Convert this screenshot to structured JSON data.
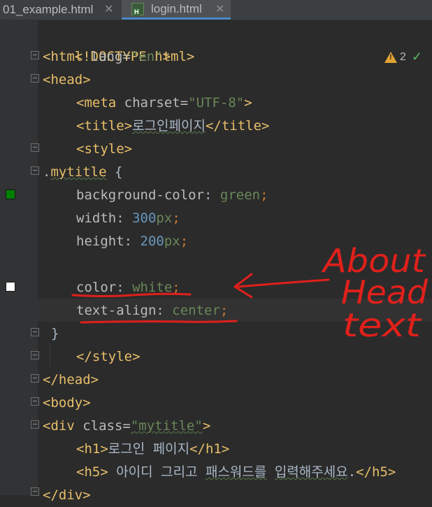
{
  "tabs": [
    {
      "label": "01_example.html",
      "close": "✕",
      "active": false
    },
    {
      "label": "login.html",
      "close": "✕",
      "active": true
    }
  ],
  "inspection": {
    "warning_count": "2",
    "icons": [
      "warning-icon",
      "check-icon"
    ]
  },
  "code": {
    "l1": {
      "a": "<!DOCTYPE html>"
    },
    "l2": {
      "a": "<html ",
      "b": "lang",
      "c": "=",
      "d": "\"en\"",
      "e": ">"
    },
    "l3": {
      "a": "<head>"
    },
    "l4": {
      "a": "<meta ",
      "b": "charset",
      "c": "=",
      "d": "\"UTF-8\"",
      "e": ">"
    },
    "l5": {
      "a": "<title>",
      "b": "로그인페이지",
      "c": "</title>"
    },
    "l6": {
      "a": "<style>"
    },
    "l7": {
      "a": ".",
      "b": "mytitle",
      "c": " {"
    },
    "l8": {
      "a": "background-color",
      "b": ": ",
      "c": "green",
      "d": ";"
    },
    "l9": {
      "a": "width",
      "b": ": ",
      "c": "300",
      "d": "px",
      "e": ";"
    },
    "l10": {
      "a": "height",
      "b": ": ",
      "c": "200",
      "d": "px",
      "e": ";"
    },
    "l12": {
      "a": "color",
      "b": ": ",
      "c": "white",
      "d": ";"
    },
    "l13": {
      "a": "text-align",
      "b": ": ",
      "c": "center",
      "d": ";"
    },
    "l14": {
      "a": "}"
    },
    "l15": {
      "a": "</style>"
    },
    "l16": {
      "a": "</head>"
    },
    "l17": {
      "a": "<body>"
    },
    "l18": {
      "a": "<div ",
      "b": "class",
      "c": "=",
      "d": "\"mytitle\"",
      "e": ">"
    },
    "l19": {
      "a": "<h1>",
      "b": "로그인 페이지",
      "c": "</h1>"
    },
    "l20": {
      "a": "<h5>",
      "b": " 아이디 그리고 ",
      "c": "패스워드를",
      "d": " ",
      "e": "입력해주세요",
      "f": ".",
      "g": "</h5>"
    },
    "l21": {
      "a": "</div>"
    }
  },
  "swatches": [
    {
      "color": "#008000"
    },
    {
      "color": "#ffffff"
    }
  ],
  "annotation": {
    "line1": "About",
    "line2": "Head",
    "line3": "text",
    "color": "#e0201b"
  },
  "colors": {
    "background": "#2b2b2b",
    "tag": "#e8bf6a",
    "string": "#6a8759",
    "number": "#6897bb",
    "keyword": "#cc7832"
  }
}
